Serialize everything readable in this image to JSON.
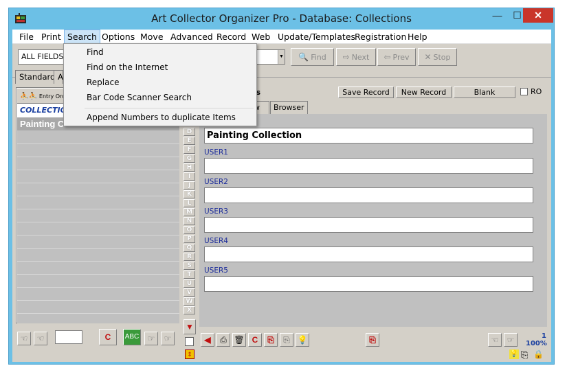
{
  "window": {
    "title": "Art Collector Organizer Pro - Database: Collections",
    "min_glyph": "—",
    "max_glyph": "☐",
    "close_glyph": "✕"
  },
  "menubar": {
    "items": [
      "File",
      "Print",
      "Search",
      "Options",
      "Move",
      "Advanced",
      "Record",
      "Web",
      "Update/Templates",
      "Registration",
      "Help"
    ],
    "active": "Search"
  },
  "search_menu": {
    "items": [
      "Find",
      "Find on the Internet",
      "Replace",
      "Bar Code Scanner Search",
      "Append Numbers to duplicate Items"
    ]
  },
  "toolbar": {
    "fields_combo_value": "ALL FIELDS",
    "find_label": "Find",
    "next_label": "Next",
    "prev_label": "Prev",
    "stop_label": "Stop"
  },
  "view_tabs": {
    "standard": "Standard",
    "second_partial": "A"
  },
  "left_panel": {
    "entry_order_label": "Entry Order",
    "collection_label": "COLLECTIO",
    "selected_item": "Painting C"
  },
  "record_bar": {
    "label_partial": "ss",
    "save_record": "Save Record",
    "new_record": "New Record",
    "blank": "Blank",
    "ro_label": "RO"
  },
  "sub_tabs": {
    "view_partial": "w",
    "browser": "Browser"
  },
  "alpha_letters": [
    "D",
    "E",
    "F",
    "G",
    "H",
    "I",
    "J",
    "K",
    "L",
    "M",
    "N",
    "O",
    "P",
    "Q",
    "R",
    "S",
    "T",
    "U",
    "V",
    "W",
    "X"
  ],
  "form": {
    "title_value": "Painting Collection",
    "fields": [
      {
        "label": "USER1",
        "value": ""
      },
      {
        "label": "USER2",
        "value": ""
      },
      {
        "label": "USER3",
        "value": ""
      },
      {
        "label": "USER4",
        "value": ""
      },
      {
        "label": "USER5",
        "value": ""
      }
    ]
  },
  "status": {
    "record_number": "1",
    "zoom": "100%"
  },
  "colors": {
    "titlebar": "#6cc0e6",
    "close_button": "#c9352a",
    "field_label": "#1a2a9a",
    "collection_text": "#1a3fa0"
  }
}
